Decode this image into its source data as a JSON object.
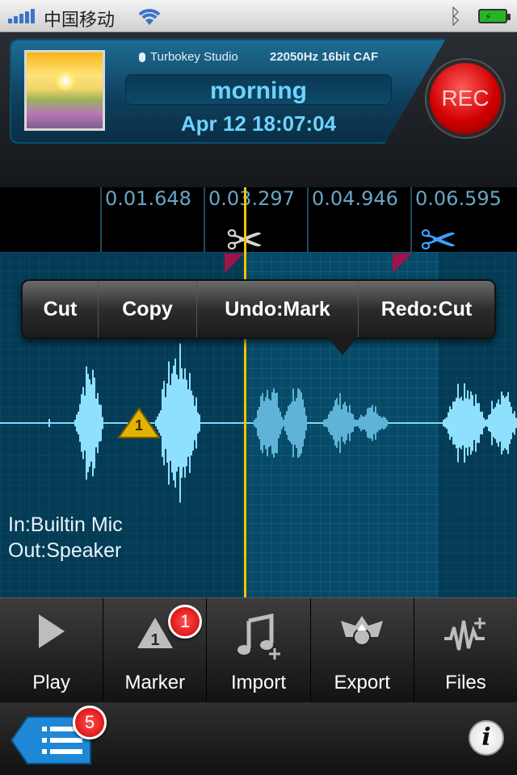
{
  "status_bar": {
    "carrier": "中国移动",
    "icons": [
      "signal-icon",
      "wifi-icon",
      "bluetooth-icon",
      "battery-charging-icon"
    ]
  },
  "recording": {
    "studio": "Turbokey Studio",
    "format": "22050Hz 16bit CAF",
    "name": "morning",
    "date": "Apr 12 18:07:04",
    "rec_label": "REC"
  },
  "timeline": {
    "ticks": [
      "0.01.648",
      "0.03.297",
      "0.04.946",
      "0.06.595"
    ]
  },
  "popup_menu": {
    "items": [
      "Cut",
      "Copy",
      "Undo:Mark",
      "Redo:Cut"
    ]
  },
  "waveform": {
    "marker_number": "1",
    "input": "In:Builtin Mic",
    "output": "Out:Speaker"
  },
  "toolbar": {
    "items": [
      {
        "label": "Play",
        "icon": "play-icon"
      },
      {
        "label": "Marker",
        "icon": "marker-icon",
        "badge": "1"
      },
      {
        "label": "Import",
        "icon": "import-music-icon"
      },
      {
        "label": "Export",
        "icon": "export-icon"
      },
      {
        "label": "Files",
        "icon": "files-icon"
      }
    ]
  },
  "bottom_bar": {
    "list_badge": "5",
    "info_label": "i"
  },
  "colors": {
    "accent": "#6dd4ff",
    "rec_red": "#d10000",
    "playhead": "#f5c400",
    "wave": "#7fd8ff"
  }
}
